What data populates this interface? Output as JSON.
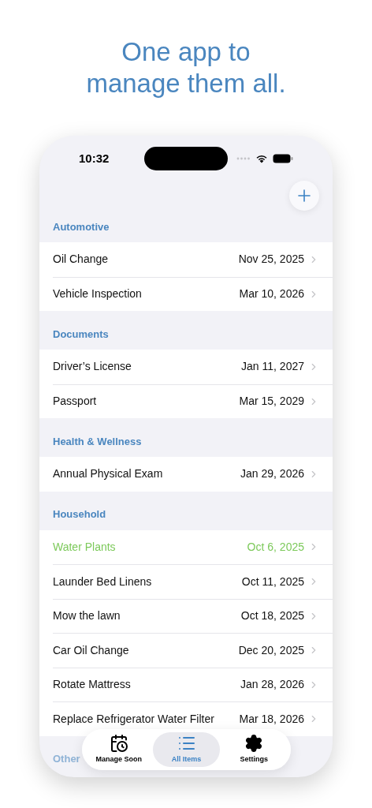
{
  "headline": [
    "One app to",
    "manage them all."
  ],
  "status_bar": {
    "time": "10:32"
  },
  "sections": [
    {
      "title": "Automotive",
      "items": [
        {
          "name": "Oil Change",
          "date": "Nov 25, 2025",
          "highlighted": false
        },
        {
          "name": "Vehicle Inspection",
          "date": "Mar 10, 2026",
          "highlighted": false
        }
      ]
    },
    {
      "title": "Documents",
      "items": [
        {
          "name": "Driver’s License",
          "date": "Jan 11, 2027",
          "highlighted": false
        },
        {
          "name": "Passport",
          "date": "Mar 15, 2029",
          "highlighted": false
        }
      ]
    },
    {
      "title": "Health & Wellness",
      "items": [
        {
          "name": "Annual Physical Exam",
          "date": "Jan 29, 2026",
          "highlighted": false
        }
      ]
    },
    {
      "title": "Household",
      "items": [
        {
          "name": "Water Plants",
          "date": "Oct 6, 2025",
          "highlighted": true
        },
        {
          "name": "Launder Bed Linens",
          "date": "Oct 11, 2025",
          "highlighted": false
        },
        {
          "name": "Mow the lawn",
          "date": "Oct 18, 2025",
          "highlighted": false
        },
        {
          "name": "Car Oil Change",
          "date": "Dec 20, 2025",
          "highlighted": false
        },
        {
          "name": "Rotate Mattress",
          "date": "Jan 28, 2026",
          "highlighted": false
        },
        {
          "name": "Replace Refrigerator Water Filter",
          "date": "Mar 18, 2026",
          "highlighted": false
        }
      ]
    },
    {
      "title": "Other"
    }
  ],
  "tabs": [
    {
      "label": "Manage Soon",
      "kind": "calendar",
      "selected": false
    },
    {
      "label": "All Items",
      "kind": "list",
      "selected": true
    },
    {
      "label": "Settings",
      "kind": "gear",
      "selected": false
    }
  ]
}
